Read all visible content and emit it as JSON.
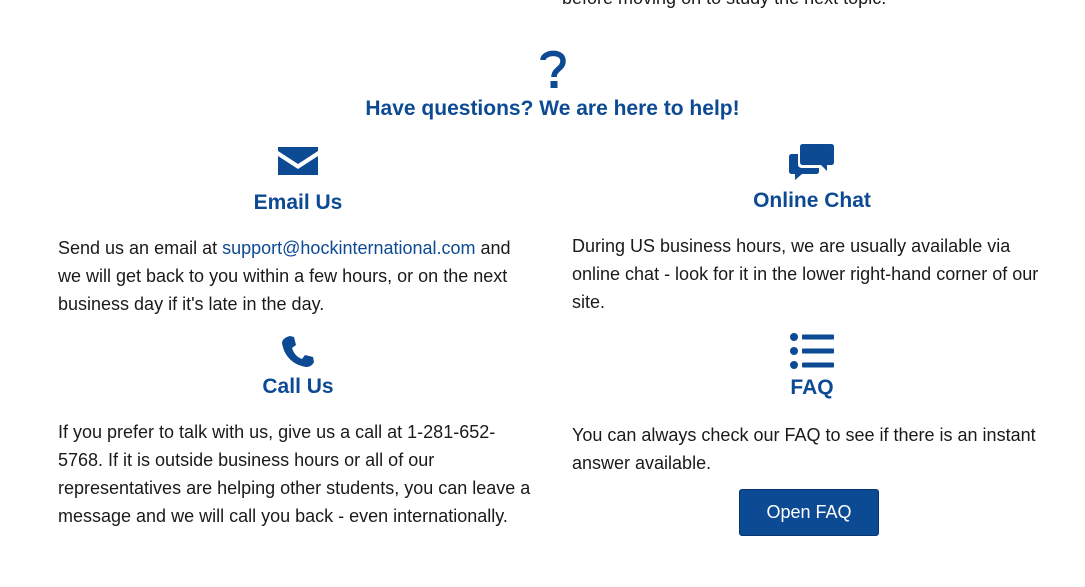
{
  "cutoff_text": "before moving on to study the next topic.",
  "help": {
    "title": "Have questions? We are here to help!",
    "icon": "question-mark-icon"
  },
  "email": {
    "icon": "envelope-icon",
    "title": "Email Us",
    "text_before": "Send us an email at ",
    "link": "support@hockinternational.com",
    "text_after": " and we will get back to you within a few hours, or on the next business day if it's late in the day."
  },
  "chat": {
    "icon": "chat-bubbles-icon",
    "title": "Online Chat",
    "text": "During US business hours, we are usually available via online chat - look for it in the lower right-hand corner of our site."
  },
  "call": {
    "icon": "phone-icon",
    "title": "Call Us",
    "text": "If you prefer to talk with us, give us a call at 1-281-652-5768. If it is outside business hours or all of our representatives are helping other students, you can leave a message and we will call you back - even internationally."
  },
  "faq": {
    "icon": "list-icon",
    "title": "FAQ",
    "text": "You can always check our FAQ to see if there is an instant answer available.",
    "button": "Open FAQ"
  },
  "colors": {
    "brand": "#0d4a94",
    "text": "#1a1a1a",
    "button_text": "#ffffff"
  }
}
